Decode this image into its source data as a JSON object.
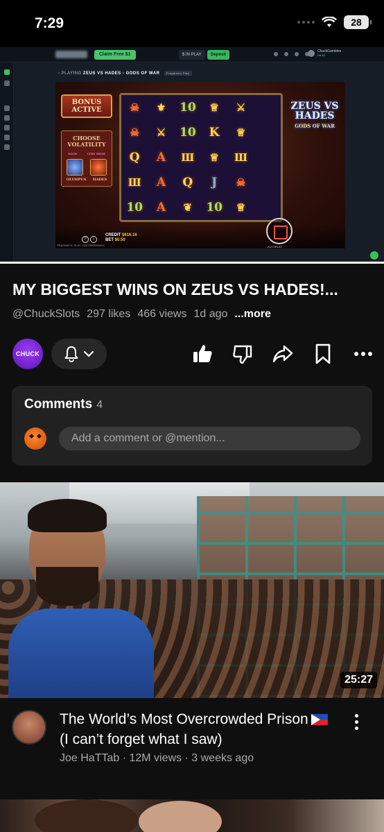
{
  "status_bar": {
    "time": "7:29",
    "battery": "28"
  },
  "player": {
    "site": {
      "claim_label": "Claim Free $1",
      "balance_label": "$ IN PLAY",
      "deposit_label": "Deposit",
      "username": "ChuckGambles",
      "user_level": "Lvl 12"
    },
    "breadcrumb": {
      "prefix": "PLAYING",
      "game": "ZEUS VS HADES - GODS OF WAR",
      "provider_badge": "Pragmatic Play"
    },
    "game": {
      "bonus_label": "BONUS ACTIVE",
      "volatility_label": "CHOOSE VOLATILITY",
      "vol_high": "HIGH",
      "vol_very_high": "VERY HIGH",
      "vol_left_name": "OLYMPUS",
      "vol_right_name": "HADES",
      "logo_main": "ZEUS VS HADES",
      "logo_sub": "GODS OF WAR",
      "credit_label": "CREDIT",
      "credit_value": "$616.16",
      "bet_label": "BET",
      "bet_value": "$0.50",
      "autoplay": "AUTOPLAY",
      "footer": "PRAGMATIC PLAY • #9175899445011",
      "symbols": [
        {
          "s": "☠",
          "c": "red"
        },
        {
          "s": "⚜",
          "c": ""
        },
        {
          "s": "10",
          "c": "green"
        },
        {
          "s": "♕",
          "c": ""
        },
        {
          "s": "⚔",
          "c": ""
        },
        {
          "s": "",
          "c": ""
        },
        {
          "s": "☠",
          "c": "red"
        },
        {
          "s": "⚔",
          "c": ""
        },
        {
          "s": "10",
          "c": "green"
        },
        {
          "s": "K",
          "c": ""
        },
        {
          "s": "♕",
          "c": ""
        },
        {
          "s": "",
          "c": ""
        },
        {
          "s": "Q",
          "c": ""
        },
        {
          "s": "A",
          "c": "red"
        },
        {
          "s": "Ш",
          "c": ""
        },
        {
          "s": "♕",
          "c": ""
        },
        {
          "s": "Ш",
          "c": ""
        },
        {
          "s": "",
          "c": ""
        },
        {
          "s": "Ш",
          "c": ""
        },
        {
          "s": "A",
          "c": "red"
        },
        {
          "s": "Q",
          "c": ""
        },
        {
          "s": "J",
          "c": "blue"
        },
        {
          "s": "☠",
          "c": "red"
        },
        {
          "s": "",
          "c": ""
        },
        {
          "s": "10",
          "c": "green"
        },
        {
          "s": "A",
          "c": "red"
        },
        {
          "s": "❦",
          "c": ""
        },
        {
          "s": "10",
          "c": "green"
        },
        {
          "s": "♕",
          "c": ""
        },
        {
          "s": "",
          "c": ""
        }
      ]
    },
    "progress": 1.0
  },
  "video": {
    "title": "MY BIGGEST WINS ON ZEUS VS HADES!...",
    "channel": "@ChuckSlots",
    "likes": "297 likes",
    "views": "466 views",
    "age": "1d ago",
    "more": "...more",
    "channel_avatar_text": "CHUCK"
  },
  "comments": {
    "title": "Comments",
    "count": "4",
    "placeholder": "Add a comment or @mention..."
  },
  "next_video": {
    "duration": "25:27",
    "title_part1": "The World’s Most Overcrowded Prison",
    "title_part2": "(I can’t forget what I saw)",
    "meta": "Joe HaTTab · 12M views · 3 weeks ago"
  },
  "icons": {
    "bell": "bell-icon",
    "chevron": "chevron-down-icon",
    "like": "thumbs-up-icon",
    "dislike": "thumbs-down-icon",
    "share": "share-icon",
    "save": "bookmark-icon",
    "more": "more-horizontal-icon"
  }
}
